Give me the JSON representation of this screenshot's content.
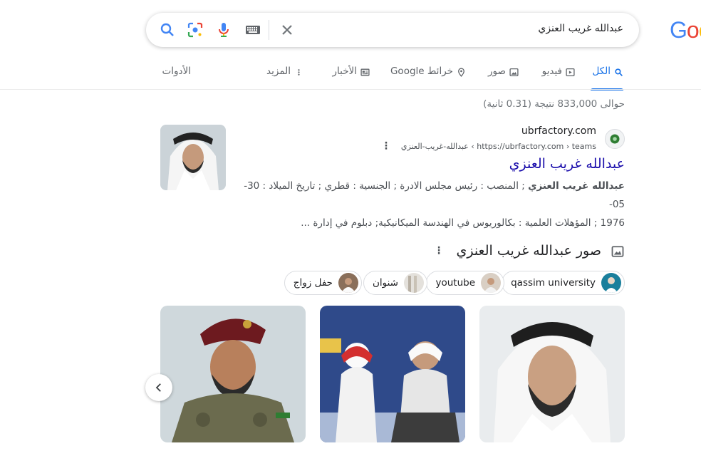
{
  "search": {
    "query": "عبدالله غريب العنزي"
  },
  "logo": {
    "text_a": "G",
    "text_b": "o",
    "text_c": "o"
  },
  "tabs": [
    {
      "label": "الكل",
      "icon": "search-icon"
    },
    {
      "label": "فيديو",
      "icon": "video-icon"
    },
    {
      "label": "صور",
      "icon": "image-icon"
    },
    {
      "label": "خرائط Google",
      "icon": "map-pin-icon"
    },
    {
      "label": "الأخبار",
      "icon": "news-icon"
    },
    {
      "label": "المزيد",
      "icon": "more-vert-icon"
    },
    {
      "label": "الأدوات"
    }
  ],
  "stats": "حوالى 833,000 نتيجة (0.31 ثانية)",
  "result": {
    "site_name": "ubrfactory.com",
    "url": "https://ubrfactory.com › teams › عبدالله-غريب-العنزي",
    "title": "عبدالله غريب العنزي",
    "snippet_bold": "عبدالله غريب العنزي",
    "snippet_line1": " ; المنصب : رئيس مجلس الادرة ; الجنسية : قطري ; تاريخ الميلاد : 30-05-",
    "snippet_line2": "1976 ; المؤهلات العلمية : بكالوريوس في الهندسة الميكانيكية; دبلوم في إدارة ..."
  },
  "images_section": {
    "heading": "صور عبدالله غريب العنزي",
    "chips": [
      "qassim university",
      "youtube",
      "شنوان",
      "حفل زواج"
    ]
  },
  "colors": {
    "accent": "#1a73e8",
    "link": "#1a0dab",
    "text": "#202124",
    "muted": "#70757a"
  }
}
